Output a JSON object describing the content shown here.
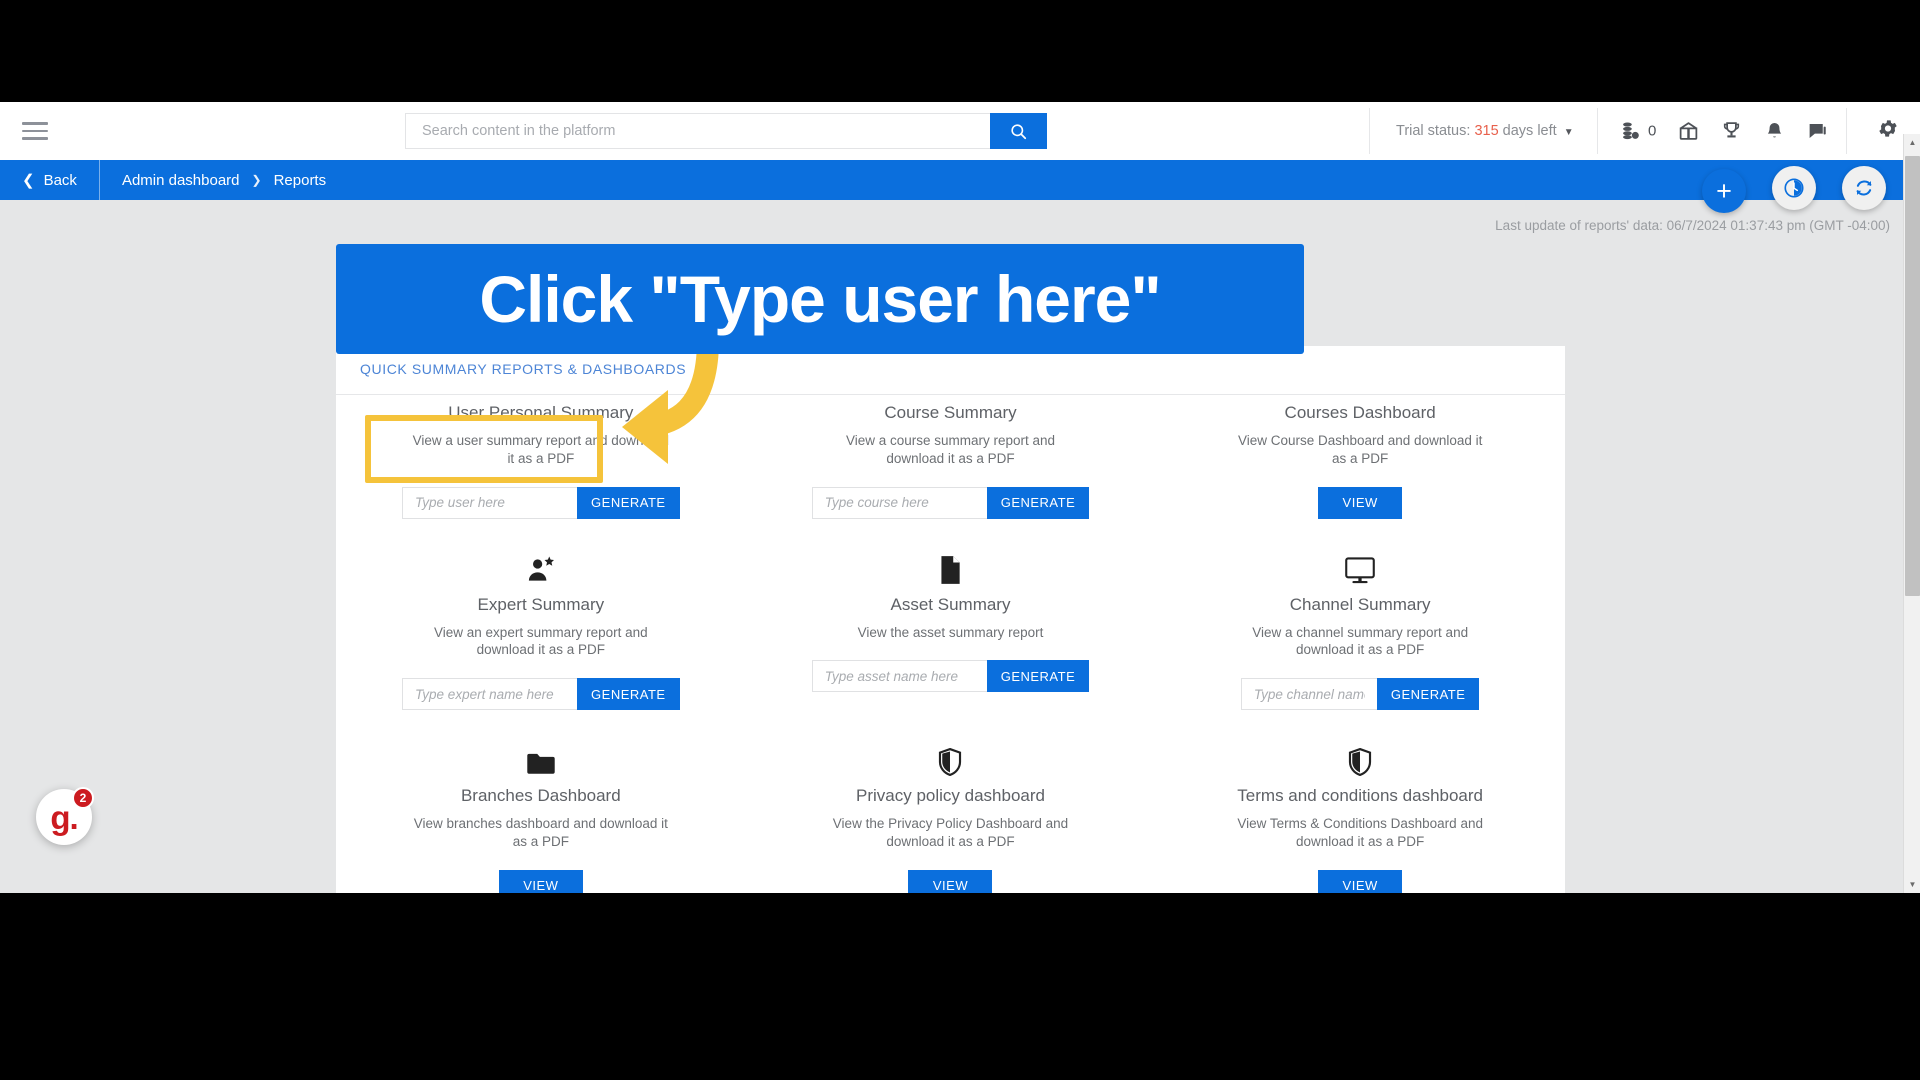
{
  "header": {
    "menu_icon": "hamburger-icon",
    "search": {
      "placeholder": "Search content in the platform",
      "value": "",
      "button_icon": "search-icon"
    },
    "trial_prefix": "Trial status:",
    "trial_days": "315",
    "trial_suffix": "days left",
    "trial_caret": "▼",
    "icons": [
      {
        "name": "points-icon",
        "count": "0"
      },
      {
        "name": "gift-calendar-icon"
      },
      {
        "name": "trophy-icon"
      },
      {
        "name": "bell-icon"
      },
      {
        "name": "chat-icon"
      },
      {
        "name": "gear-icon"
      }
    ]
  },
  "breadcrumb": {
    "back_label": "Back",
    "back_chevron": "❮",
    "items": [
      "Admin dashboard",
      "Reports"
    ],
    "separator": "❯"
  },
  "toolbar": {
    "last_update": "Last update of reports' data: 06/7/2024 01:37:43 pm (GMT -04:00)",
    "fab_add": "+",
    "fab_clock": "clock-icon",
    "fab_refresh": "refresh-icon"
  },
  "panel": {
    "tab_label": "QUICK SUMMARY REPORTS & DASHBOARDS",
    "cards": [
      {
        "icon": "user-icon",
        "title": "User Personal Summary",
        "desc": "View a user summary report and download it as a PDF",
        "input_placeholder": "Type user here",
        "input_value": "",
        "button": "GENERATE",
        "action": "input"
      },
      {
        "icon": "course-icon",
        "title": "Course Summary",
        "desc": "View a course summary report and download it as a PDF",
        "input_placeholder": "Type course here",
        "input_value": "",
        "button": "GENERATE",
        "action": "input"
      },
      {
        "icon": "dashboard-icon",
        "title": "Courses Dashboard",
        "desc": "View Course Dashboard and download it as a PDF",
        "button": "VIEW",
        "action": "button"
      },
      {
        "icon": "expert-icon",
        "title": "Expert Summary",
        "desc": "View an expert summary report and download it as a PDF",
        "input_placeholder": "Type expert name here",
        "input_value": "",
        "button": "GENERATE",
        "action": "input"
      },
      {
        "icon": "asset-file-icon",
        "title": "Asset Summary",
        "desc": "View the asset summary report",
        "input_placeholder": "Type asset name here",
        "input_value": "",
        "button": "GENERATE",
        "action": "input"
      },
      {
        "icon": "monitor-icon",
        "title": "Channel Summary",
        "desc": "View a channel summary report and download it as a PDF",
        "input_placeholder": "Type channel name here",
        "input_value": "",
        "button": "GENERATE",
        "action": "input"
      },
      {
        "icon": "folder-icon",
        "title": "Branches Dashboard",
        "desc": "View branches dashboard and download it as a PDF",
        "button": "VIEW",
        "action": "button"
      },
      {
        "icon": "shield-icon",
        "title": "Privacy policy dashboard",
        "desc": "View the Privacy Policy Dashboard and download it as a PDF",
        "button": "VIEW",
        "action": "button"
      },
      {
        "icon": "shield-icon",
        "title": "Terms and conditions dashboard",
        "desc": "View Terms & Conditions Dashboard and download it as a PDF",
        "button": "VIEW",
        "action": "button"
      }
    ]
  },
  "annotation": {
    "banner_text": "Click \"Type user here\"",
    "banner_color": "#0b6fdd",
    "highlight_color": "#f5c33b",
    "arrow_color": "#f5c33b"
  },
  "guru_widget": {
    "logo_text": "g.",
    "badge_count": "2",
    "logo_color": "#cc1b20"
  },
  "scrollbar": {
    "up_arrow": "▲",
    "down_arrow": "▼"
  }
}
